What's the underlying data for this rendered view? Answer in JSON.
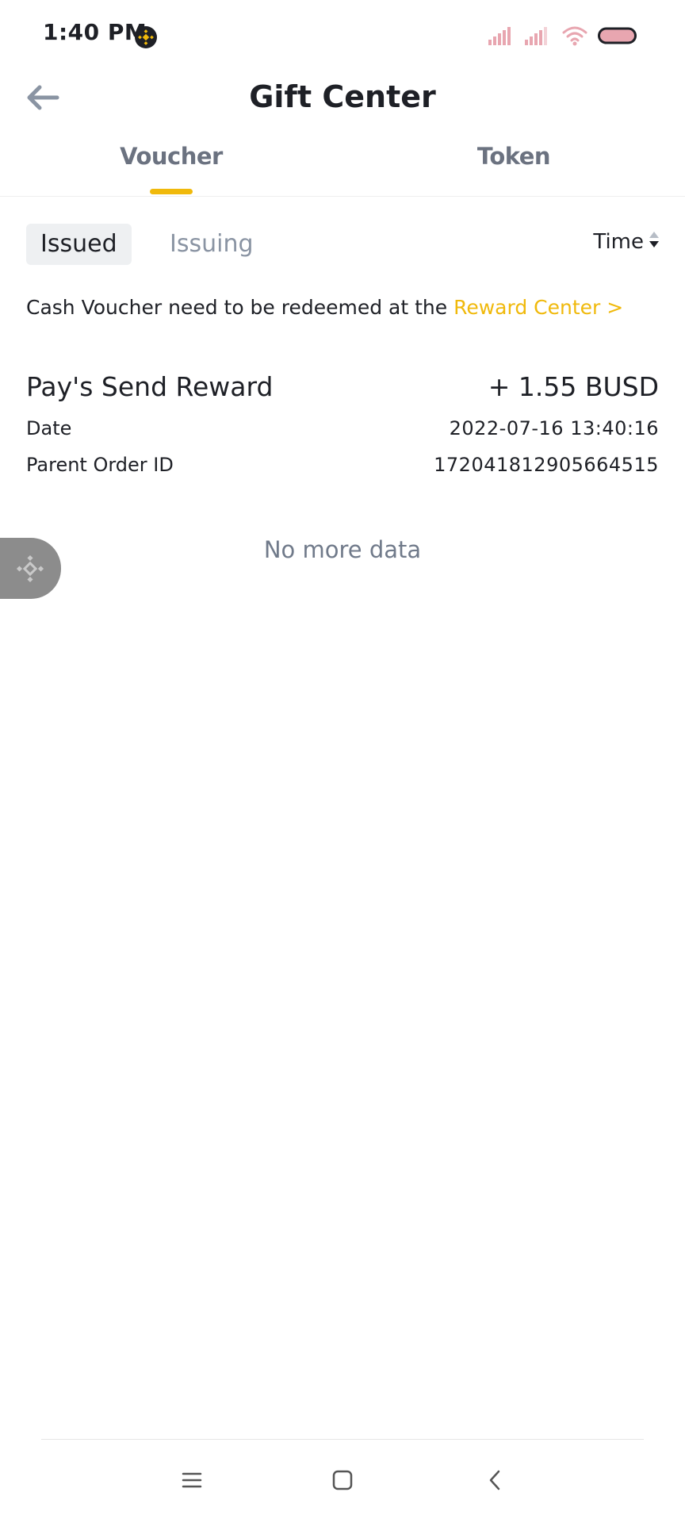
{
  "status_bar": {
    "time": "1:40 PM",
    "app_icon": "binance-logo-icon",
    "icons": [
      "signal-icon",
      "signal-icon",
      "wifi-icon",
      "battery-icon"
    ],
    "battery_color": "#e8a6b0"
  },
  "header": {
    "back_icon": "arrow-left-icon",
    "title": "Gift Center"
  },
  "tabs": {
    "items": [
      {
        "label": "Voucher",
        "active": true
      },
      {
        "label": "Token",
        "active": false
      }
    ],
    "indicator_color": "#f0b90b"
  },
  "filters": {
    "chips": [
      {
        "label": "Issued",
        "selected": true
      },
      {
        "label": "Issuing",
        "selected": false
      }
    ],
    "sort_label": "Time",
    "sort_icon": "sort-arrows-icon"
  },
  "notice": {
    "text": "Cash Voucher need to be redeemed at the",
    "link": "Reward Center >",
    "link_color": "#f0b90b"
  },
  "records": [
    {
      "title": "Pay's Send Reward",
      "amount": "+ 1.55 BUSD",
      "fields": [
        {
          "label": "Date",
          "value": "2022-07-16 13:40:16"
        },
        {
          "label": "Parent Order ID",
          "value": "172041812905664515"
        }
      ]
    }
  ],
  "empty_message": "No more data",
  "floating_button": {
    "icon": "binance-diamond-icon"
  },
  "nav_bar": {
    "icons": [
      "menu-icon",
      "home-square-icon",
      "back-chevron-icon"
    ]
  }
}
